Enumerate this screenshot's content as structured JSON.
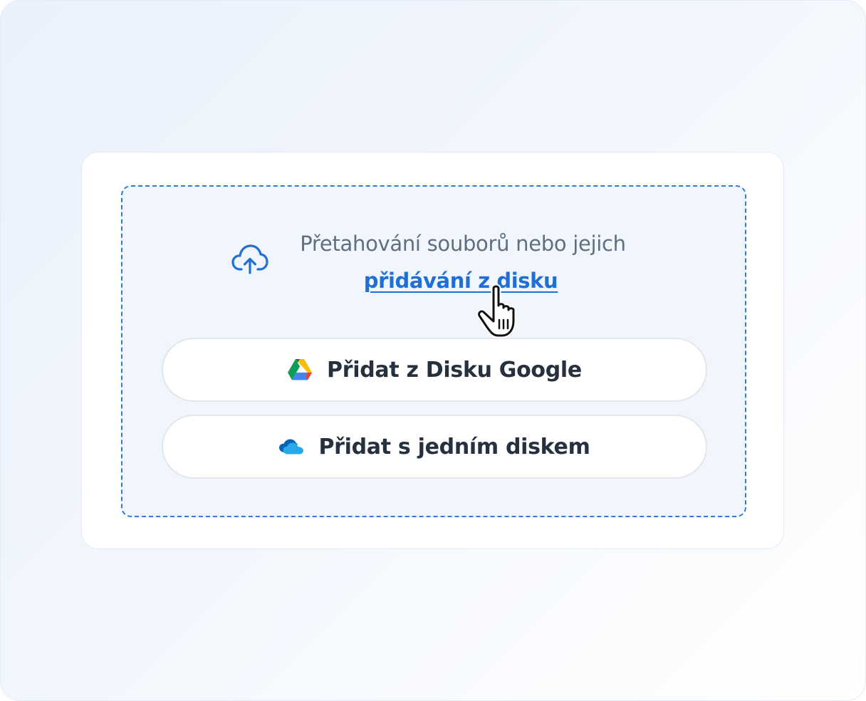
{
  "dropzone": {
    "prompt": "Přetahování souborů nebo jejich",
    "link_label": "přidávání z disku",
    "upload_icon": "cloud-upload-icon"
  },
  "sources": [
    {
      "label": "Přidat z Disku Google",
      "icon": "google-drive-icon"
    },
    {
      "label": "Přidat s jedním diskem",
      "icon": "onedrive-icon"
    }
  ],
  "cursor": {
    "icon": "hand-pointer-icon"
  },
  "colors": {
    "accent": "#1f6fd6",
    "dashed_border": "#2f7ae0",
    "text_muted": "#5f6f7f",
    "text_dark": "#263140",
    "dropzone_bg": "#f1f6fd"
  }
}
